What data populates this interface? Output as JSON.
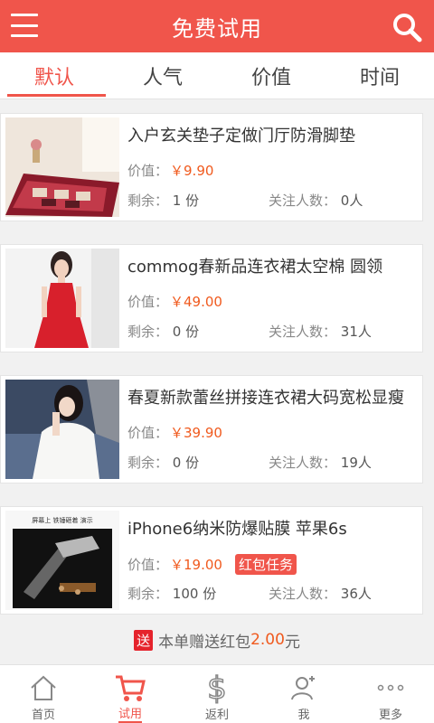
{
  "header": {
    "title": "免费试用",
    "menu_icon": "menu-icon",
    "search_icon": "search-icon"
  },
  "tabs": [
    {
      "label": "默认",
      "active": true
    },
    {
      "label": "人气",
      "active": false
    },
    {
      "label": "价值",
      "active": false
    },
    {
      "label": "时间",
      "active": false
    }
  ],
  "products": [
    {
      "name": "入户玄关垫子定做门厅防滑脚垫",
      "price_label": "价值：",
      "price": "￥9.90",
      "remaining_label": "剩余：",
      "remaining": "1 份",
      "followers_label": "关注人数：",
      "followers": "0人",
      "badge": ""
    },
    {
      "name": "commog春新品连衣裙太空棉 圆领",
      "price_label": "价值：",
      "price": "￥49.00",
      "remaining_label": "剩余：",
      "remaining": "0 份",
      "followers_label": "关注人数：",
      "followers": "31人",
      "badge": ""
    },
    {
      "name": "春夏新款蕾丝拼接连衣裙大码宽松显瘦",
      "price_label": "价值：",
      "price": "￥39.90",
      "remaining_label": "剩余：",
      "remaining": "0 份",
      "followers_label": "关注人数：",
      "followers": "19人",
      "badge": ""
    },
    {
      "name": "iPhone6纳米防爆贴膜 苹果6s",
      "price_label": "价值：",
      "price": "￥19.00",
      "remaining_label": "剩余：",
      "remaining": "100 份",
      "followers_label": "关注人数：",
      "followers": "36人",
      "badge": "红包任务"
    }
  ],
  "thumb_caption": "屏幕上 铁锤砸着 演示",
  "coupon": {
    "tag": "送",
    "text": "本单赠送红包",
    "amount": "2.00",
    "unit": "元"
  },
  "bottom_nav": [
    {
      "label": "首页",
      "icon": "home-icon",
      "active": false
    },
    {
      "label": "试用",
      "icon": "cart-icon",
      "active": true
    },
    {
      "label": "返利",
      "icon": "dollar-icon",
      "active": false
    },
    {
      "label": "我",
      "icon": "user-icon",
      "active": false
    },
    {
      "label": "更多",
      "icon": "more-icon",
      "active": false
    }
  ],
  "colors": {
    "brand": "#f0554b",
    "price": "#f05a1e"
  }
}
